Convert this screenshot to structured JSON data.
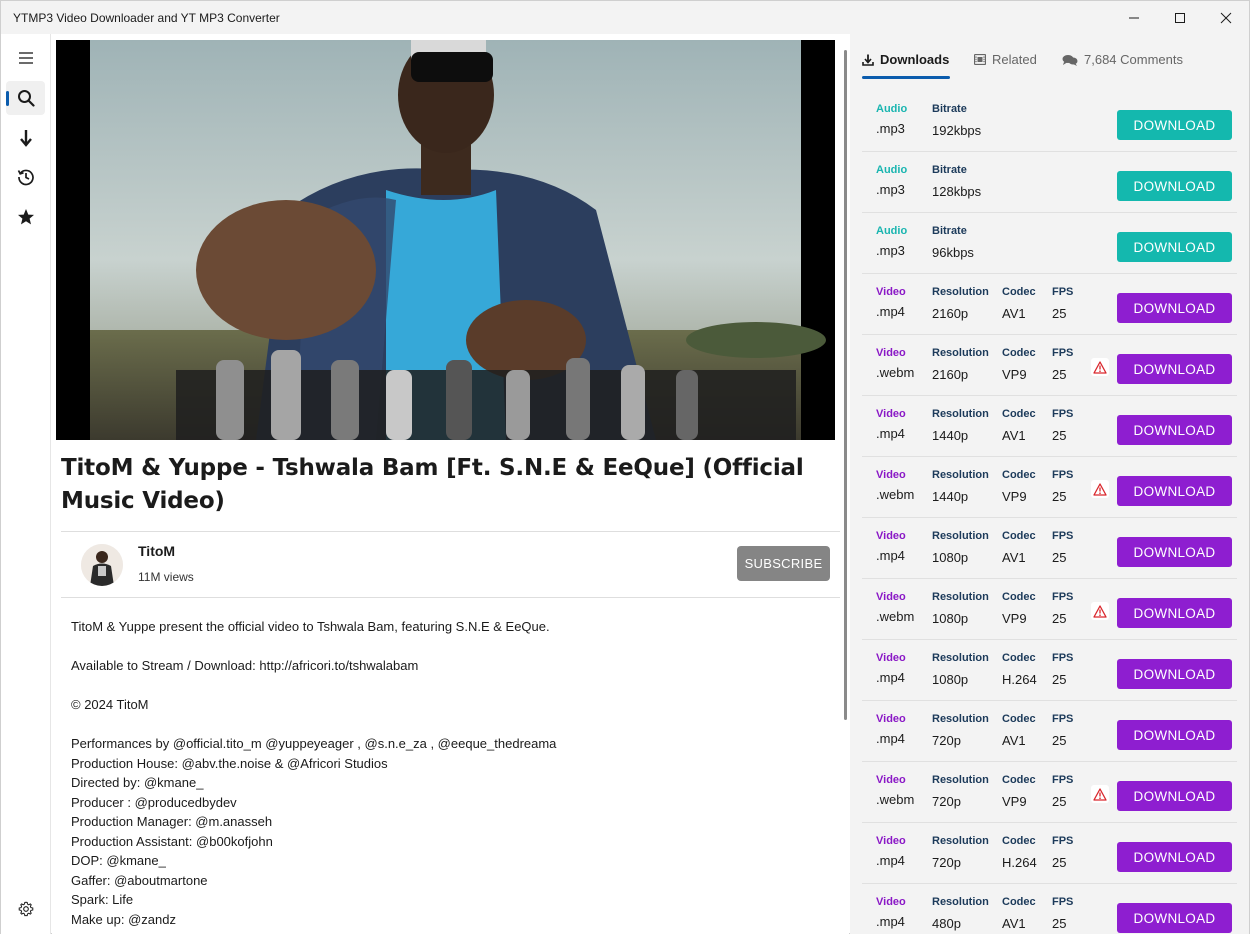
{
  "window": {
    "title": "YTMP3 Video Downloader and YT MP3 Converter"
  },
  "video": {
    "title": "TitoM & Yuppe - Tshwala Bam [Ft. S.N.E & EeQue] (Official Music Video)",
    "channel": "TitoM",
    "views": "11M views",
    "subscribe_label": "SUBSCRIBE"
  },
  "description": [
    "TitoM & Yuppe present the official video to Tshwala Bam, featuring S.N.E & EeQue.",
    "",
    "Available to Stream / Download: http://africori.to/tshwalabam",
    "",
    "© 2024 TitoM",
    "",
    "Performances by @official.tito_m @yuppeyeager , @s.n.e_za , @eeque_thedreama",
    "Production House: @abv.the.noise & @Africori Studios",
    "Directed by: @kmane_",
    "Producer : @producedbydev",
    "Production Manager: @m.anasseh",
    "Production Assistant: @b00kofjohn",
    "DOP: @kmane_",
    "Gaffer: @aboutmartone",
    "Spark: Life",
    "Make up: @zandz"
  ],
  "tabs": {
    "downloads": "Downloads",
    "related": "Related",
    "comments": "7,684 Comments"
  },
  "labels": {
    "audio": "Audio",
    "video": "Video",
    "bitrate": "Bitrate",
    "resolution": "Resolution",
    "codec": "Codec",
    "fps": "FPS",
    "download": "DOWNLOAD"
  },
  "downloads": [
    {
      "kind": "audio",
      "ext": ".mp3",
      "bitrate": "192kbps"
    },
    {
      "kind": "audio",
      "ext": ".mp3",
      "bitrate": "128kbps"
    },
    {
      "kind": "audio",
      "ext": ".mp3",
      "bitrate": "96kbps"
    },
    {
      "kind": "video",
      "ext": ".mp4",
      "resolution": "2160p",
      "codec": "AV1",
      "fps": "25",
      "warning": false
    },
    {
      "kind": "video",
      "ext": ".webm",
      "resolution": "2160p",
      "codec": "VP9",
      "fps": "25",
      "warning": true
    },
    {
      "kind": "video",
      "ext": ".mp4",
      "resolution": "1440p",
      "codec": "AV1",
      "fps": "25",
      "warning": false
    },
    {
      "kind": "video",
      "ext": ".webm",
      "resolution": "1440p",
      "codec": "VP9",
      "fps": "25",
      "warning": true
    },
    {
      "kind": "video",
      "ext": ".mp4",
      "resolution": "1080p",
      "codec": "AV1",
      "fps": "25",
      "warning": false
    },
    {
      "kind": "video",
      "ext": ".webm",
      "resolution": "1080p",
      "codec": "VP9",
      "fps": "25",
      "warning": true
    },
    {
      "kind": "video",
      "ext": ".mp4",
      "resolution": "1080p",
      "codec": "H.264",
      "fps": "25",
      "warning": false
    },
    {
      "kind": "video",
      "ext": ".mp4",
      "resolution": "720p",
      "codec": "AV1",
      "fps": "25",
      "warning": false
    },
    {
      "kind": "video",
      "ext": ".webm",
      "resolution": "720p",
      "codec": "VP9",
      "fps": "25",
      "warning": true
    },
    {
      "kind": "video",
      "ext": ".mp4",
      "resolution": "720p",
      "codec": "H.264",
      "fps": "25",
      "warning": false
    },
    {
      "kind": "video",
      "ext": ".mp4",
      "resolution": "480p",
      "codec": "AV1",
      "fps": "25",
      "warning": false
    }
  ],
  "colors": {
    "audio_accent": "#14b8ae",
    "video_accent": "#8e1ed0",
    "nav_indicator": "#0b5cad",
    "warning": "#d9262c"
  },
  "icons": {
    "nav": [
      "hamburger-menu-icon",
      "search-icon",
      "download-arrow-icon",
      "history-icon",
      "star-icon"
    ],
    "settings": "gear-icon",
    "tabs": [
      "download-icon",
      "film-icon",
      "comments-icon"
    ],
    "row_warning": "warning-triangle-icon"
  }
}
